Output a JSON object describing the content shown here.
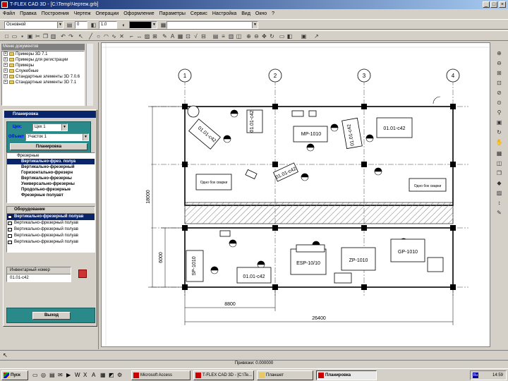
{
  "window": {
    "title": "T-FLEX CAD 3D - [C:\\Temp\\Чертеж.grb]"
  },
  "menu": [
    "Файл",
    "Правка",
    "Построения",
    "Чертеж",
    "Операции",
    "Оформление",
    "Параметры",
    "Сервис",
    "Настройка",
    "Вид",
    "Окно",
    "?"
  ],
  "toolbar1": {
    "layer": "Основной",
    "width": "0",
    "scale": "1.0",
    "style_value": ""
  },
  "left_tree": {
    "title": "Меню документов",
    "items": [
      "Примеры 3D 7.1",
      "Примеры для регистрации",
      "Примеры",
      "Служебные",
      "Стандартные элементы 3D 7.0.6",
      "Стандартные элементы 3D 7.1"
    ]
  },
  "dialog": {
    "title": "Планировка",
    "type_label": "Цех:",
    "type_value": "Цех 1",
    "object_label": "Объект",
    "object_value": "Участок 1",
    "action_button": "Планировка",
    "tree_root": "Фрезерные",
    "tree_items": [
      "Вертикально-фрез. полуа",
      "Вертикально-фрезерный",
      "Горизонтально-фрезерн",
      "Вертикально-фрезерны",
      "Универсально-фрезерны",
      "Продольно-фрезерные",
      "Фрезерные полуавт"
    ],
    "equip_header": "Оборудование",
    "equip_items": [
      "Вертикально-фрезерный полуав",
      "Вертикально-фрезерный полуав",
      "Вертикально-фрезерный полуав",
      "Вертикально-фрезерный полуав",
      "Вертикально-фрезерный полуав"
    ],
    "inv_header": "Инвентарный номер",
    "inv_value": "01.01-с42",
    "exit_button": "Выход"
  },
  "drawing": {
    "axis_labels": [
      "1",
      "2",
      "3",
      "4"
    ],
    "dimensions": {
      "total_width": "26400",
      "bay": "8800",
      "height": "18000",
      "lower": "6000"
    },
    "machines": [
      "01.01-с42",
      "МР-1010",
      "01.01-с42",
      "01.01-с42",
      "01.01-с42",
      "01.01-с42",
      "SP-1010",
      "01.01-с42",
      "ESP-10/10",
      "ZP-1010",
      "GP-1010"
    ],
    "notes": [
      "Одно бок сварки",
      "Одно бок сварки"
    ]
  },
  "status": {
    "text": "Привязки: 0.000000"
  },
  "taskbar": {
    "start": "Пуск",
    "tasks": [
      "Microsoft Access",
      "T-FLEX CAD 3D - [C:\\Te...",
      "Планшет",
      "Планировка"
    ],
    "clock": "14:59"
  }
}
